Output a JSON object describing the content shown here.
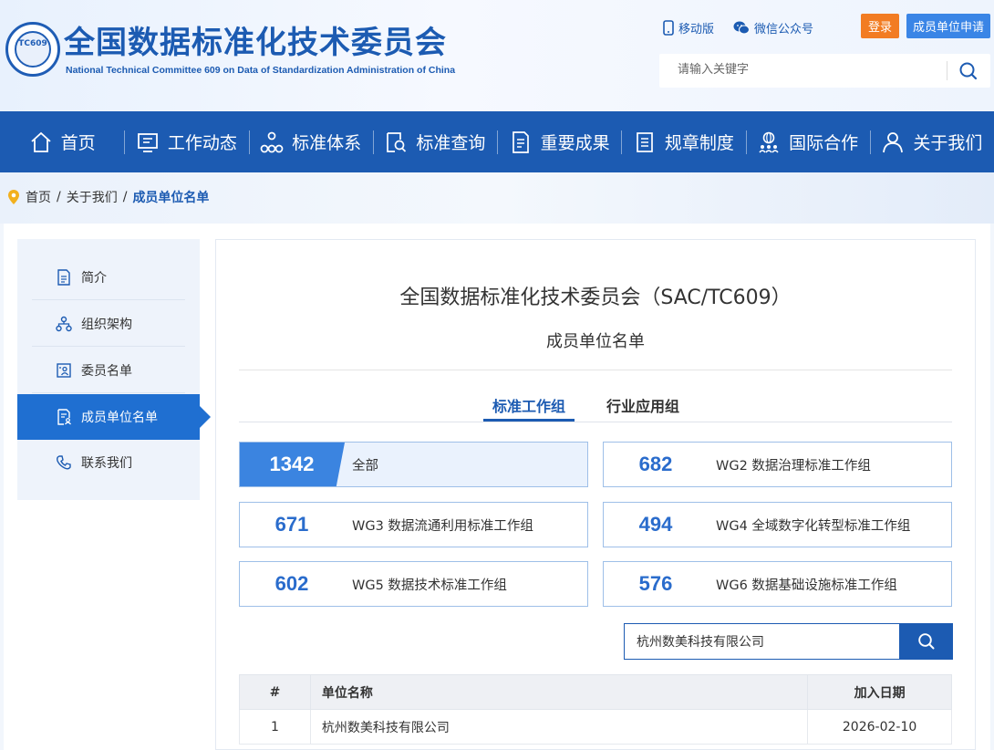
{
  "header": {
    "logo_text": "TC609",
    "title": "全国数据标准化技术委员会",
    "subtitle": "National Technical Committee 609 on Data of Standardization Administration of China",
    "mobile_label": "移动版",
    "wechat_label": "微信公众号",
    "login_label": "登录",
    "apply_label": "成员单位申请",
    "search_placeholder": "请输入关键字"
  },
  "nav": [
    {
      "label": "首页",
      "icon": "home-icon"
    },
    {
      "label": "工作动态",
      "icon": "monitor-icon"
    },
    {
      "label": "标准体系",
      "icon": "network-icon"
    },
    {
      "label": "标准查询",
      "icon": "doc-search-icon"
    },
    {
      "label": "重要成果",
      "icon": "doc-icon"
    },
    {
      "label": "规章制度",
      "icon": "list-icon"
    },
    {
      "label": "国际合作",
      "icon": "globe-people-icon"
    },
    {
      "label": "关于我们",
      "icon": "user-icon"
    }
  ],
  "breadcrumb": {
    "home": "首页",
    "sep1": "/",
    "parent": "关于我们",
    "sep2": "/",
    "current": "成员单位名单"
  },
  "sidebar": {
    "items": [
      {
        "label": "简介",
        "icon": "doc-icon"
      },
      {
        "label": "组织架构",
        "icon": "org-icon"
      },
      {
        "label": "委员名单",
        "icon": "person-card-icon"
      },
      {
        "label": "成员单位名单",
        "icon": "member-doc-icon"
      },
      {
        "label": "联系我们",
        "icon": "phone-icon"
      }
    ],
    "active_index": 3
  },
  "main": {
    "title": "全国数据标准化技术委员会（SAC/TC609）",
    "subtitle": "成员单位名单",
    "tabs": [
      "标准工作组",
      "行业应用组"
    ],
    "groups": [
      {
        "count": "1342",
        "label": "全部",
        "selected": true
      },
      {
        "count": "682",
        "label": "WG2 数据治理标准工作组"
      },
      {
        "count": "671",
        "label": "WG3 数据流通利用标准工作组"
      },
      {
        "count": "494",
        "label": "WG4 全域数字化转型标准工作组"
      },
      {
        "count": "602",
        "label": "WG5 数据技术标准工作组"
      },
      {
        "count": "576",
        "label": "WG6 数据基础设施标准工作组"
      }
    ],
    "search_value": "杭州数美科技有限公司",
    "table": {
      "headers": [
        "#",
        "单位名称",
        "加入日期"
      ],
      "rows": [
        {
          "index": "1",
          "name": "杭州数美科技有限公司",
          "date": "2026-02-10"
        }
      ]
    }
  },
  "colors": {
    "brand_blue": "#1c5bb2",
    "accent_blue": "#3b84e0",
    "orange": "#f27c22"
  }
}
